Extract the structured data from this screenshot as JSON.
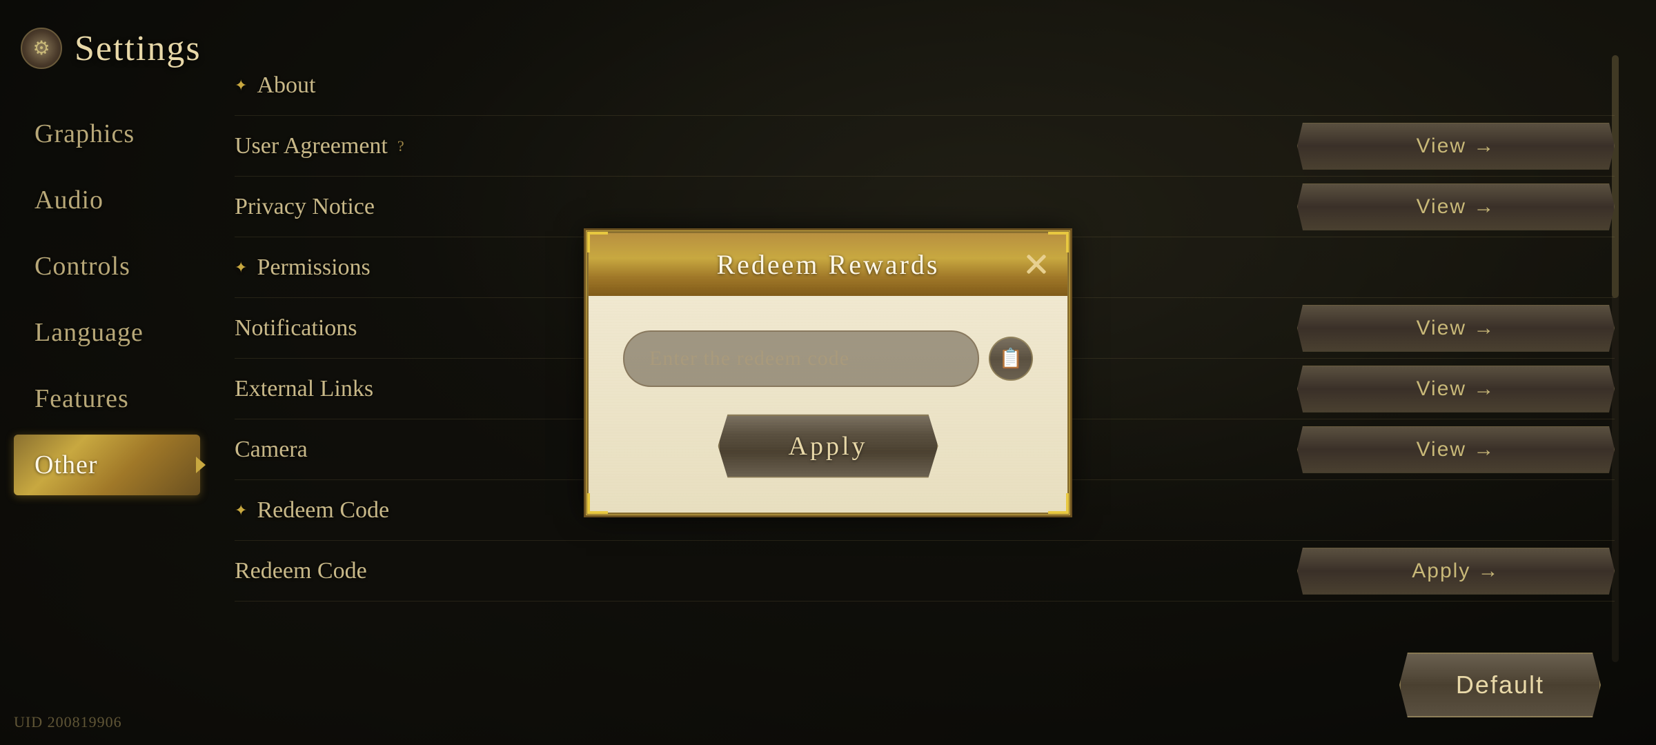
{
  "title": "Settings",
  "uid": "UID 200819906",
  "sidebar": {
    "icon": "⚙",
    "items": [
      {
        "id": "graphics",
        "label": "Graphics",
        "active": false
      },
      {
        "id": "audio",
        "label": "Audio",
        "active": false
      },
      {
        "id": "controls",
        "label": "Controls",
        "active": false
      },
      {
        "id": "language",
        "label": "Language",
        "active": false
      },
      {
        "id": "features",
        "label": "Features",
        "active": false
      },
      {
        "id": "other",
        "label": "Other",
        "active": true
      }
    ]
  },
  "rows": [
    {
      "id": "about",
      "label": "About",
      "diamond": true,
      "action": null
    },
    {
      "id": "user-agreement",
      "label": "User Agreement",
      "hasQuestion": true,
      "diamond": false,
      "action": "View →"
    },
    {
      "id": "privacy",
      "label": "Privacy Notice",
      "diamond": false,
      "action": "View →"
    },
    {
      "id": "permissions",
      "label": "Permissions",
      "diamond": true,
      "action": null
    },
    {
      "id": "notifications",
      "label": "Notifications",
      "diamond": false,
      "action": "View →"
    },
    {
      "id": "external",
      "label": "External Links",
      "diamond": false,
      "action": "View →"
    },
    {
      "id": "camera",
      "label": "Camera",
      "diamond": false,
      "action": "View →"
    },
    {
      "id": "redeem-code-section",
      "label": "Redeem Code",
      "diamond": true,
      "action": null
    },
    {
      "id": "redeem-code",
      "label": "Redeem Code",
      "diamond": false,
      "action": "Apply →"
    }
  ],
  "buttons": {
    "default_label": "Default"
  },
  "modal": {
    "title": "Redeem Rewards",
    "input_placeholder": "Enter the redeem code",
    "apply_label": "Apply",
    "close_label": "×"
  }
}
